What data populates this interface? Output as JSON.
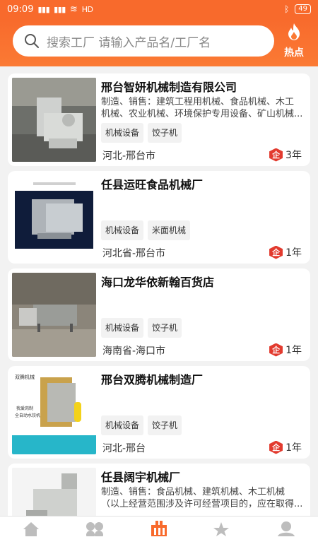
{
  "status": {
    "time": "09:09",
    "signal1": "Ƨ",
    "signal2": "Ƨ",
    "wifi": "≋",
    "hd": "HD",
    "battery": "49"
  },
  "search": {
    "placeholder": "搜索工厂 请输入产品名/工厂名"
  },
  "hot": {
    "label": "热点"
  },
  "listings": [
    {
      "title": "邢台智妍机械制造有限公司",
      "desc_lines": [
        "制造、销售：建筑工程用机械、食品机械、木工",
        "机械、农业机械、环境保护专用设备、矿山机械..."
      ],
      "tags": [
        "机械设备",
        "饺子机"
      ],
      "location": "河北-邢台市",
      "badge": "企",
      "years": "3年"
    },
    {
      "title": "任县运旺食品机械厂",
      "desc_lines": [],
      "tags": [
        "机械设备",
        "米面机械"
      ],
      "location": "河北省-邢台市",
      "badge": "企",
      "years": "1年"
    },
    {
      "title": "海口龙华依新翰百货店",
      "desc_lines": [],
      "tags": [
        "机械设备",
        "饺子机"
      ],
      "location": "海南省-海口市",
      "badge": "企",
      "years": "1年"
    },
    {
      "title": "邢台双腾机械制造厂",
      "desc_lines": [],
      "tags": [
        "机械设备",
        "饺子机"
      ],
      "location": "河北-邢台",
      "badge": "企",
      "years": "1年",
      "image_text": [
        "双腾机械",
        "我爱岗制",
        "全自动水饺机"
      ]
    },
    {
      "title": "任县阔宇机械厂",
      "desc_lines": [
        "制造、销售：食品机械、建筑机械、木工机械",
        "（以上经营范围涉及许可经营项目的，应在取得..."
      ],
      "tags": [],
      "location": "",
      "badge": "",
      "years": ""
    }
  ],
  "colors": {
    "brand": "#f86a2c",
    "badge": "#e23a2e",
    "tab_active": "#f86a2c",
    "tab_inactive": "#bdbdbd"
  },
  "tabs": [
    {
      "icon": "home-icon",
      "active": false
    },
    {
      "icon": "category-icon",
      "active": false
    },
    {
      "icon": "factory-icon",
      "active": true
    },
    {
      "icon": "star-icon",
      "active": false
    },
    {
      "icon": "user-icon",
      "active": false
    }
  ]
}
